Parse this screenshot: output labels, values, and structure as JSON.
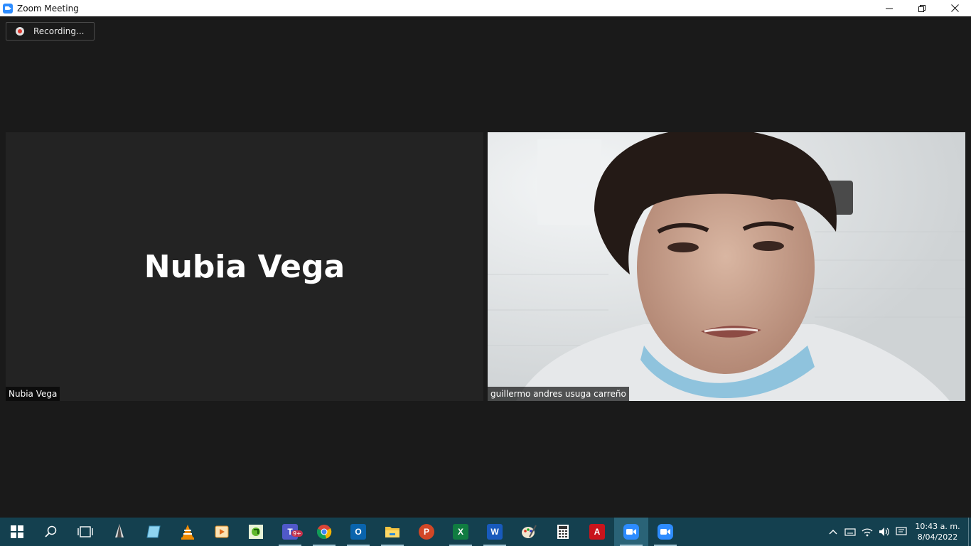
{
  "window": {
    "title": "Zoom Meeting",
    "controls": {
      "minimize": "—",
      "restore": "❐",
      "close": "✕"
    }
  },
  "recording": {
    "label": "Recording..."
  },
  "participants": [
    {
      "name": "Nubia Vega",
      "display_name_center": "Nubia Vega",
      "video": false
    },
    {
      "name": "guillermo andres usuga carreño",
      "video": true
    }
  ],
  "taskbar": {
    "apps": [
      "start-icon",
      "search-icon",
      "task-view-icon",
      "inkscape-icon",
      "notepad-icon",
      "vlc-icon",
      "media-player-icon",
      "greenshot-icon",
      "teams-icon",
      "chrome-icon",
      "outlook-icon",
      "file-explorer-icon",
      "powerpoint-icon",
      "excel-icon",
      "word-icon",
      "paint-icon",
      "calculator-icon",
      "acrobat-icon",
      "zoom-icon",
      "zoom-meeting-icon"
    ],
    "teams_badge": "9+",
    "clock": {
      "time": "10:43 a. m.",
      "date": "8/04/2022"
    }
  },
  "colors": {
    "taskbar": "#14404f",
    "meeting_bg": "#1a1a1a",
    "zoom_blue": "#2d8cff"
  }
}
